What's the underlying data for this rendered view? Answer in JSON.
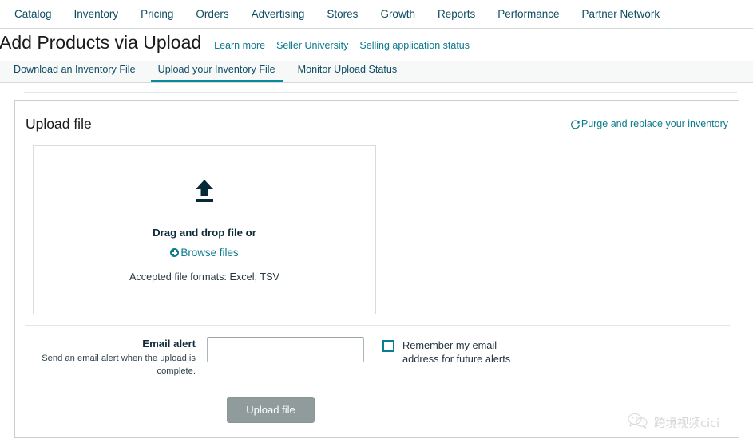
{
  "topnav": {
    "items": [
      {
        "label": "Catalog",
        "name": "nav-catalog"
      },
      {
        "label": "Inventory",
        "name": "nav-inventory"
      },
      {
        "label": "Pricing",
        "name": "nav-pricing"
      },
      {
        "label": "Orders",
        "name": "nav-orders"
      },
      {
        "label": "Advertising",
        "name": "nav-advertising"
      },
      {
        "label": "Stores",
        "name": "nav-stores"
      },
      {
        "label": "Growth",
        "name": "nav-growth"
      },
      {
        "label": "Reports",
        "name": "nav-reports"
      },
      {
        "label": "Performance",
        "name": "nav-performance"
      },
      {
        "label": "Partner Network",
        "name": "nav-partner-network"
      }
    ]
  },
  "header": {
    "title": "Add Products via Upload",
    "links": [
      {
        "label": "Learn more"
      },
      {
        "label": "Seller University"
      },
      {
        "label": "Selling application status"
      }
    ]
  },
  "tabs": [
    {
      "label": "Download an Inventory File",
      "active": false
    },
    {
      "label": "Upload your Inventory File",
      "active": true
    },
    {
      "label": "Monitor Upload Status",
      "active": false
    }
  ],
  "panel": {
    "title": "Upload file",
    "purge_link": "Purge and replace your inventory",
    "purge_icon": "refresh-icon"
  },
  "dropzone": {
    "icon": "upload-arrow-icon",
    "drag_text": "Drag and drop file or",
    "browse_label": "Browse files",
    "browse_icon": "plus-circle-icon",
    "formats_text": "Accepted file formats: Excel, TSV"
  },
  "email_alert": {
    "label": "Email alert",
    "description": "Send an email alert when the upload is complete.",
    "input_value": "",
    "input_placeholder": "",
    "remember_label": "Remember my email address for future alerts",
    "remember_checked": false
  },
  "actions": {
    "upload_button": "Upload file"
  },
  "watermark": {
    "icon": "wechat-icon",
    "text": "跨境视频cici"
  },
  "colors": {
    "accent_teal": "#0a8a9a",
    "link_teal": "#0a7a8c",
    "nav_blue": "#0f4c63",
    "button_gray": "#909c9c"
  }
}
